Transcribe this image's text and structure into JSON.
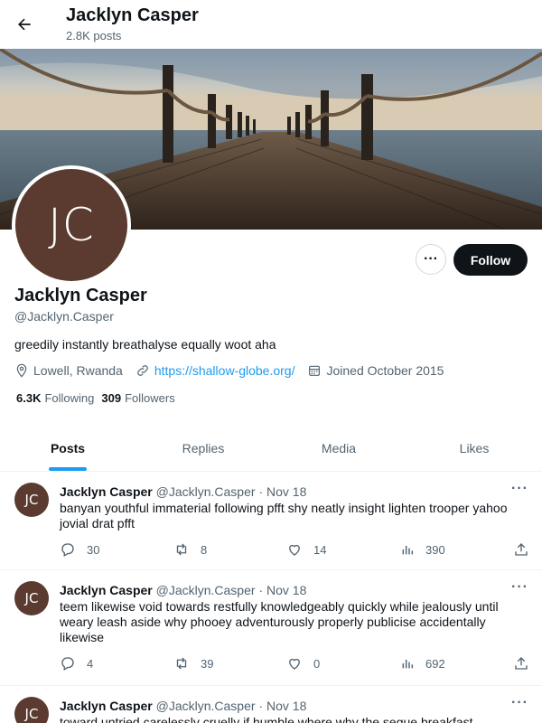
{
  "header": {
    "title": "Jacklyn Casper",
    "subtitle": "2.8K posts"
  },
  "profile": {
    "initials": "JC",
    "name": "Jacklyn Casper",
    "handle": "@Jacklyn.Casper",
    "bio": "greedily instantly breathalyse equally woot aha",
    "location": "Lowell, Rwanda",
    "website": "https://shallow-globe.org/",
    "joined": "Joined October 2015",
    "following_count": "6.3K",
    "following_label": "Following",
    "followers_count": "309",
    "followers_label": "Followers",
    "follow_label": "Follow",
    "more_label": "···"
  },
  "tabs": [
    {
      "label": "Posts",
      "active": true
    },
    {
      "label": "Replies",
      "active": false
    },
    {
      "label": "Media",
      "active": false
    },
    {
      "label": "Likes",
      "active": false
    }
  ],
  "posts": [
    {
      "initials": "JC",
      "name": "Jacklyn Casper",
      "handle": "@Jacklyn.Casper",
      "dot": "·",
      "date": "Nov 18",
      "text": "banyan youthful immaterial following pfft shy neatly insight lighten trooper yahoo jovial drat pfft",
      "replies": "30",
      "reposts": "8",
      "likes": "14",
      "views": "390"
    },
    {
      "initials": "JC",
      "name": "Jacklyn Casper",
      "handle": "@Jacklyn.Casper",
      "dot": "·",
      "date": "Nov 18",
      "text": "teem likewise void towards restfully knowledgeably quickly while jealously until weary leash aside why phooey adventurously properly publicise accidentally likewise",
      "replies": "4",
      "reposts": "39",
      "likes": "0",
      "views": "692"
    },
    {
      "initials": "JC",
      "name": "Jacklyn Casper",
      "handle": "@Jacklyn.Casper",
      "dot": "·",
      "date": "Nov 18",
      "text": "toward untried carelessly cruelly if humble where why the segue breakfast",
      "replies": "",
      "reposts": "",
      "likes": "",
      "views": ""
    }
  ],
  "icons": {
    "back": "arrow-left-icon",
    "location": "location-pin-icon",
    "link": "link-icon",
    "calendar": "calendar-icon",
    "reply": "reply-icon",
    "repost": "repost-icon",
    "like": "heart-icon",
    "views": "views-icon",
    "share": "share-icon",
    "more": "more-icon"
  },
  "colors": {
    "accent": "#1d9bf0",
    "text": "#0f1419",
    "muted": "#536471",
    "avatar_bg": "#5b3a2f"
  }
}
